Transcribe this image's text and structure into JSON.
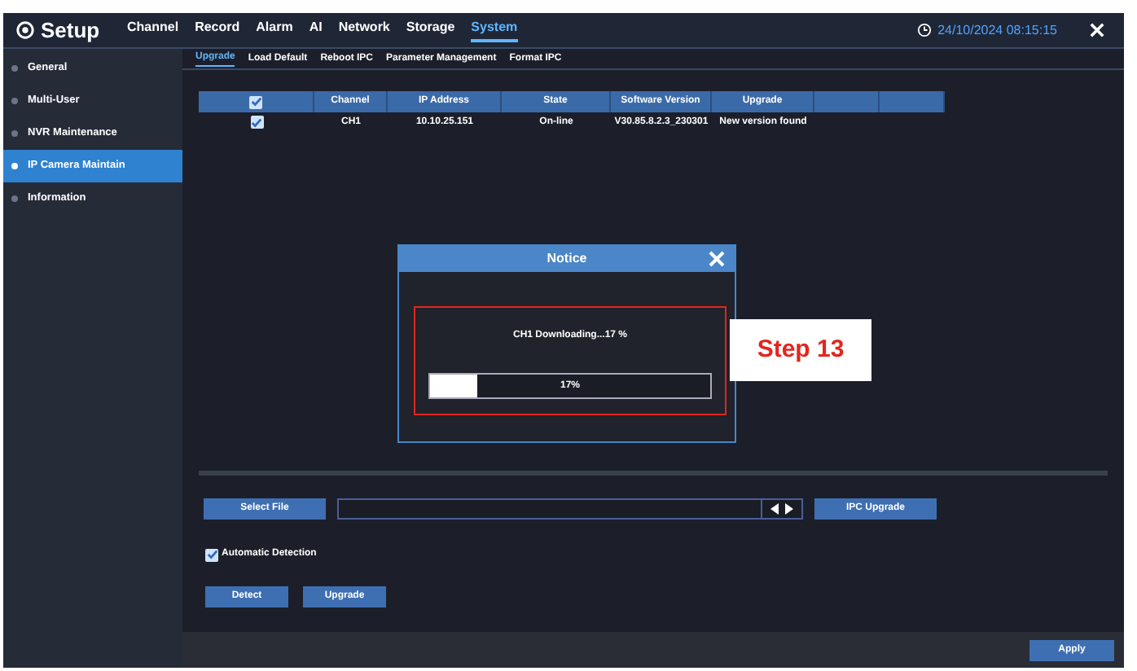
{
  "header": {
    "title": "Setup",
    "menu": [
      {
        "label": "Channel",
        "selected": false
      },
      {
        "label": "Record",
        "selected": false
      },
      {
        "label": "Alarm",
        "selected": false
      },
      {
        "label": "AI",
        "selected": false
      },
      {
        "label": "Network",
        "selected": false
      },
      {
        "label": "Storage",
        "selected": false
      },
      {
        "label": "System",
        "selected": true
      }
    ],
    "datetime": "24/10/2024 08:15:15"
  },
  "sidebar": {
    "items": [
      {
        "label": "General",
        "selected": false
      },
      {
        "label": "Multi-User",
        "selected": false
      },
      {
        "label": "NVR Maintenance",
        "selected": false
      },
      {
        "label": "IP Camera Maintain",
        "selected": true
      },
      {
        "label": "Information",
        "selected": false
      }
    ]
  },
  "subtabs": [
    {
      "label": "Upgrade",
      "selected": true
    },
    {
      "label": "Load Default",
      "selected": false
    },
    {
      "label": "Reboot IPC",
      "selected": false
    },
    {
      "label": "Parameter Management",
      "selected": false
    },
    {
      "label": "Format IPC",
      "selected": false
    }
  ],
  "table": {
    "header_checked": true,
    "columns": [
      "Channel",
      "IP Address",
      "State",
      "Software Version",
      "Upgrade"
    ],
    "rows": [
      {
        "checked": true,
        "cells": [
          "CH1",
          "10.10.25.151",
          "On-line",
          "V30.85.8.2.3_230301",
          "New version found"
        ]
      }
    ]
  },
  "notice": {
    "title": "Notice",
    "message": "CH1 Downloading...17 %",
    "progress": {
      "level": 0.17,
      "reading": "17%"
    }
  },
  "annotation": {
    "label": "Step 13"
  },
  "controls": {
    "select_file": "Select File",
    "ipc_upgrade": "IPC Upgrade",
    "auto_detection": {
      "label": "Automatic Detection",
      "checked": true
    },
    "detect": "Detect",
    "upgrade": "Upgrade",
    "apply": "Apply"
  }
}
